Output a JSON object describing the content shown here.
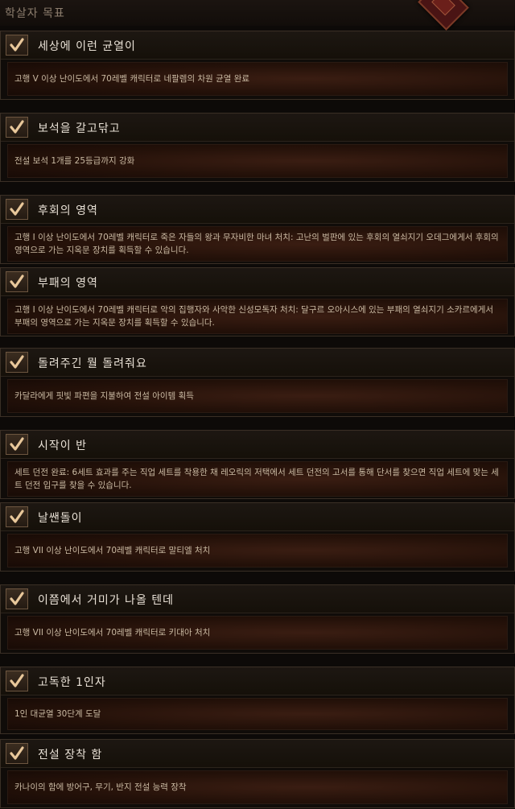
{
  "header": {
    "title": "학살자 목표"
  },
  "achievements": [
    {
      "name": "세상에 이런 균열이",
      "description": "고행 V 이상 난이도에서 70레벨 캐릭터로 네팔렘의 차원 균열 완료",
      "completed": true
    },
    {
      "name": "보석을 갈고닦고",
      "description": "전설 보석 1개를 25등급까지 강화",
      "completed": true
    },
    {
      "name": "후회의 영역",
      "description": "고행 I 이상 난이도에서 70레벨 캐릭터로 죽은 자들의 왕과 무자비한 마녀 처치: 고난의 벌판에 있는 후회의 열쇠지기 오데그에게서 후회의 영역으로 가는 지옥문 장치를 획득할 수 있습니다.",
      "completed": true
    },
    {
      "name": "부패의 영역",
      "description": "고행 I 이상 난이도에서 70레벨 캐릭터로 악의 집행자와 사악한 신성모독자 처치: 달구르 오아시스에 있는 부패의 열쇠지기 소카르에게서 부패의 영역으로 가는 지옥문 장치를 획득할 수 있습니다.",
      "completed": true
    },
    {
      "name": "돌려주긴 뭘 돌려줘요",
      "description": "카달라에게 핏빛 파편을 지불하여 전설 아이템 획득",
      "completed": true
    },
    {
      "name": "시작이 반",
      "description": "세트 던전 완료: 6세트 효과를 주는 직업 세트를 착용한 채 레오릭의 저택에서 세트 던전의 고서를 통해 단서를 찾으면 직업 세트에 맞는 세트 던전 입구를 찾을 수 있습니다.",
      "completed": true
    },
    {
      "name": "날쌘돌이",
      "description": "고행 VII 이상 난이도에서 70레벨 캐릭터로 말티엘 처치",
      "completed": true
    },
    {
      "name": "이쯤에서 거미가 나올 텐데",
      "description": "고행 VII 이상 난이도에서 70레벨 캐릭터로 키대아 처치",
      "completed": true
    },
    {
      "name": "고독한 1인자",
      "description": "1인 대균열 30단계 도달",
      "completed": true
    },
    {
      "name": "전설 장착 함",
      "description": "카나이의 함에 방어구, 무기, 반지 전설 능력 장착",
      "completed": true
    }
  ],
  "colors": {
    "check": "#e8c79a",
    "title_text": "#e9e1d6",
    "desc_text": "#c9b9a2",
    "desc_bg": "#2b140b"
  },
  "icons": {
    "check": "checkmark-icon",
    "emblem": "crest-emblem-icon"
  }
}
